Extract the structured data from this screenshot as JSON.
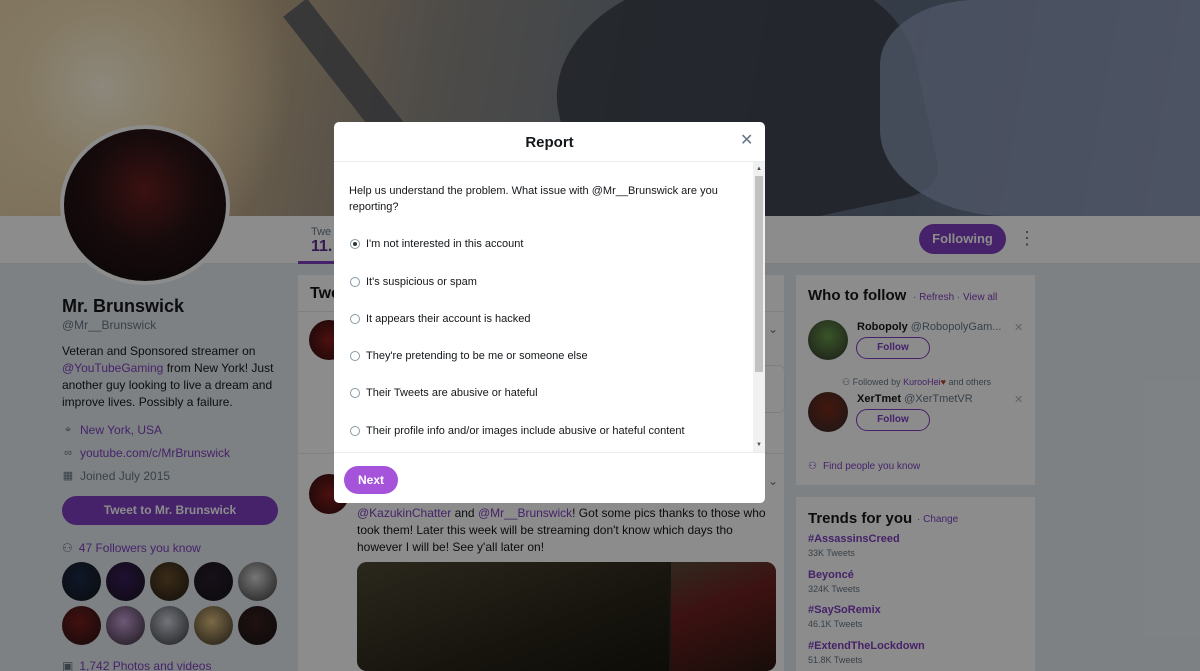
{
  "profile": {
    "name": "Mr. Brunswick",
    "handle": "@Mr__Brunswick",
    "bio_part1": "Veteran and Sponsored streamer on ",
    "bio_link": "@YouTubeGaming",
    "bio_part2": " from New York! Just another guy looking to live a dream and improve lives. Possibly a failure.",
    "location": "New York, USA",
    "website": "youtube.com/c/MrBrunswick",
    "joined": "Joined July 2015",
    "tweet_to_label": "Tweet to Mr. Brunswick",
    "followers_you_know": "47 Followers you know",
    "photos_videos": "1,742 Photos and videos",
    "followers_colors": [
      "#1c2c4a",
      "#3a1f5c",
      "#6b4f2a",
      "#2a1e2e",
      "#d8d8d8",
      "#7a1e1e",
      "#c9a0d8",
      "#d0d4e0",
      "#e0c080",
      "#3a2020"
    ]
  },
  "navbar": {
    "tab_label": "Twe",
    "tab_count": "11.",
    "following_label": "Following",
    "more_icon": "more-vertical-icon"
  },
  "timeline": {
    "header": "Twe",
    "tweet2": {
      "mention1": "@KazukinChatter",
      "and_text": " and ",
      "mention2": "@Mr__Brunswick",
      "text": "! Got some pics thanks to those who took them! Later this week will be streaming don't know which days tho however I will be! See y'all later on!"
    }
  },
  "who_to_follow": {
    "title": "Who to follow",
    "refresh": "Refresh",
    "view_all": "View all",
    "separator": "·",
    "suggestions": [
      {
        "name": "Robopoly",
        "handle": "@RobopolyGam...",
        "follow_label": "Follow",
        "avatar_color": "#6a9a4a"
      },
      {
        "name": "XerTmet",
        "handle": "@XerTmetVR",
        "follow_label": "Follow",
        "avatar_color": "#7a2a1a"
      }
    ],
    "followed_by_prefix": "Followed by ",
    "followed_by_user": "KurooHei",
    "followed_by_suffix": " and others",
    "find_people": "Find people you know"
  },
  "trends": {
    "title": "Trends for you",
    "change": "Change",
    "items": [
      {
        "name": "#AssassinsCreed",
        "count": "33K Tweets"
      },
      {
        "name": "Beyoncé",
        "count": "324K Tweets"
      },
      {
        "name": "#SaySoRemix",
        "count": "46.1K Tweets"
      },
      {
        "name": "#ExtendTheLockdown",
        "count": "51.8K Tweets"
      }
    ]
  },
  "modal": {
    "title": "Report",
    "close_icon": "close-icon",
    "question": "Help us understand the problem. What issue with @Mr__Brunswick are you reporting?",
    "options": [
      {
        "label": "I'm not interested in this account",
        "checked": true
      },
      {
        "label": "It's suspicious or spam",
        "checked": false
      },
      {
        "label": "It appears their account is hacked",
        "checked": false
      },
      {
        "label": "They're pretending to be me or someone else",
        "checked": false
      },
      {
        "label": "Their Tweets are abusive or hateful",
        "checked": false
      },
      {
        "label": "Their profile info and/or images include abusive or hateful content",
        "checked": false
      }
    ],
    "next_label": "Next"
  },
  "colors": {
    "accent": "#7e3fbf",
    "next_button": "#a553db",
    "overlay": "rgba(0,0,0,0.45)"
  }
}
